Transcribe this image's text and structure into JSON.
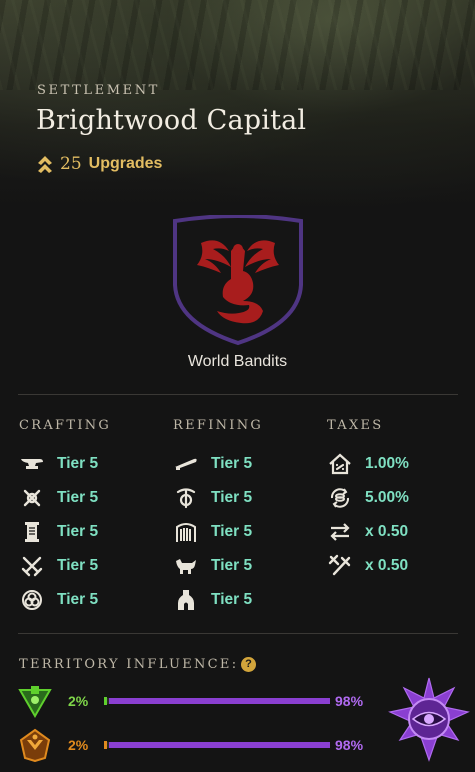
{
  "header": {
    "label": "SETTLEMENT",
    "name": "Brightwood Capital",
    "upgrades_count": "25",
    "upgrades_label": "Upgrades",
    "upgrade_icon": "chevron-up-double-icon"
  },
  "faction": {
    "name": "World Bandits",
    "crest_icon": "red-dragon-crest-icon",
    "crest_colors": {
      "shield": "#1a1a1a",
      "border": "#5a3a8a",
      "emblem": "#a01c1c"
    }
  },
  "crafting": {
    "title": "CRAFTING",
    "items": [
      {
        "icon": "anvil-icon",
        "value": "Tier 5"
      },
      {
        "icon": "crossed-tools-icon",
        "value": "Tier 5"
      },
      {
        "icon": "scroll-icon",
        "value": "Tier 5"
      },
      {
        "icon": "crossed-swords-icon",
        "value": "Tier 5"
      },
      {
        "icon": "rune-circle-icon",
        "value": "Tier 5"
      }
    ]
  },
  "refining": {
    "title": "REFINING",
    "items": [
      {
        "icon": "blade-icon",
        "value": "Tier 5"
      },
      {
        "icon": "pickaxe-gear-icon",
        "value": "Tier 5"
      },
      {
        "icon": "loom-icon",
        "value": "Tier 5"
      },
      {
        "icon": "tannery-icon",
        "value": "Tier 5"
      },
      {
        "icon": "furnace-icon",
        "value": "Tier 5"
      }
    ]
  },
  "taxes": {
    "title": "TAXES",
    "items": [
      {
        "icon": "house-tax-icon",
        "value": "1.00%"
      },
      {
        "icon": "coins-cycle-icon",
        "value": "5.00%"
      },
      {
        "icon": "trade-arrows-icon",
        "value": "x 0.50"
      },
      {
        "icon": "hammer-fee-icon",
        "value": "x 0.50"
      }
    ]
  },
  "influence": {
    "title": "TERRITORY INFLUENCE:",
    "help_icon": "question-icon",
    "help_text": "?",
    "rows": [
      {
        "icon": "syndicate-faction-icon",
        "left": "2%",
        "right": "98%",
        "left_color": "#5fcf2d",
        "share": 0.98
      },
      {
        "icon": "marauders-faction-icon",
        "left": "2%",
        "right": "98%",
        "left_color": "#e08a1e",
        "share": 0.98
      }
    ],
    "owner_icon": "covenant-eye-emblem-icon",
    "owner_color": "#8a3fd1"
  }
}
